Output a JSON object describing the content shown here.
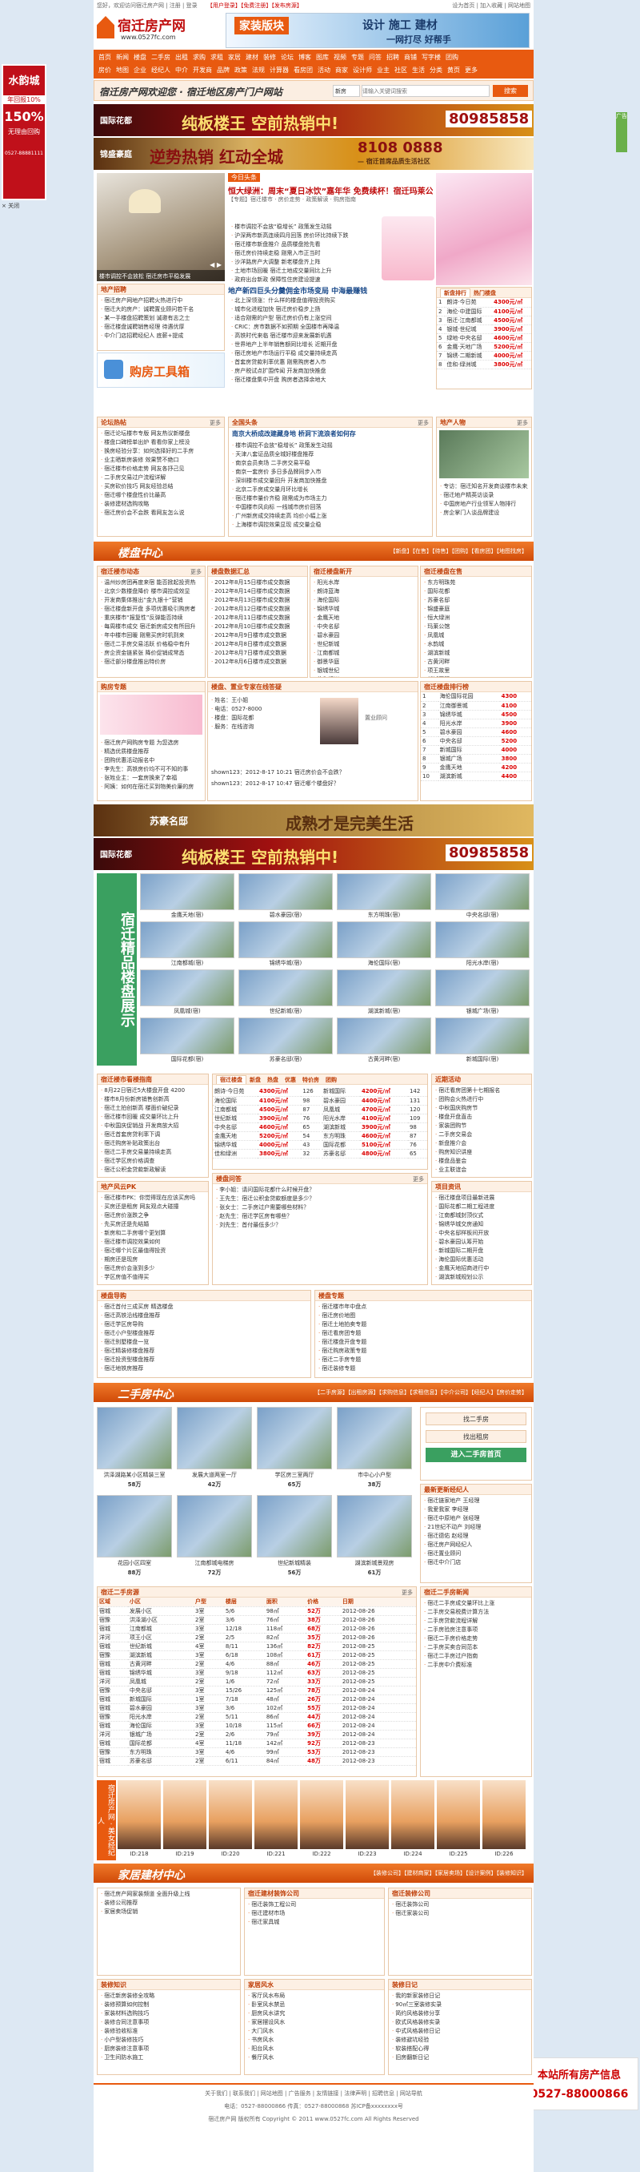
{
  "topbar": {
    "left": "您好，欢迎访问宿迁房产网 | 注册 | 登录",
    "mid": "【用户登录】【免费注册】【发布房源】",
    "right": "设为首页 | 加入收藏 | 网站地图"
  },
  "logo": {
    "cn": "宿迁房产网",
    "url": "www.0527fc.com"
  },
  "header_ad": {
    "left": "家装版块",
    "right": "设计 施工 建材",
    "sub": "一网打尽 好帮手"
  },
  "nav": {
    "row1": [
      "首页",
      "新闻",
      "楼盘",
      "二手房",
      "出租",
      "求购",
      "求租",
      "家居",
      "建材",
      "装修",
      "论坛",
      "博客",
      "图库",
      "视频",
      "专题",
      "问答",
      "招聘",
      "商铺",
      "写字楼",
      "团购"
    ],
    "row2": [
      "房价",
      "地图",
      "企业",
      "经纪人",
      "中介",
      "开发商",
      "品牌",
      "政策",
      "法规",
      "计算器",
      "看房团",
      "活动",
      "商家",
      "设计师",
      "业主",
      "社区",
      "生活",
      "分类",
      "黄页",
      "更多"
    ]
  },
  "slogan": "宿迁房产网欢迎您 · 宿迁地区房产门户网站",
  "search": {
    "placeholder": "请输入关键词搜索",
    "select": "新房",
    "button": "搜索"
  },
  "ads": {
    "gold_phone": "80985858",
    "gold_title": "纯板楼王 空前热销中!",
    "gold_brand": "国际花都",
    "red_title": "逆势热销 红动全城",
    "red_phone": "8108 0888",
    "red_brand": "锦盛豪庭",
    "red_sub": "— 宿迁首席品质生活社区",
    "sugar_brand": "苏豪名邸",
    "sugar_title": "成熟才是完美生活",
    "left_float": {
      "name": "水韵城",
      "line1": "年回报10%",
      "line2": "150%",
      "line3": "无理由回购",
      "phone": "0527-88881111"
    },
    "right_float": {
      "title": "本站所有房产信息",
      "phone": "0527-88000866"
    }
  },
  "headline": {
    "tag": "今日头条",
    "title1": "恒大绿洲：周末“夏日冰饮”嘉年华 免费续杯！宿迁玛莱公馆：沐周周",
    "sub": "【专题】宿迁楼市 · 房价走势 · 政策解读 · 购房指南",
    "items": [
      "楼市调控不会放“稳增长” 政策发生动摇",
      "沪深两市新高连续四月回落 房价环比持续下跌",
      "宿迁楼市新盘推介 品质楼盘抢先看",
      "宿迁房价持续走稳 刚需入市正当时",
      "沙洋路房产大调整 新老楼盘齐上阵",
      "土地市场回暖 宿迁土地成交量同比上升",
      "政府出台新政 保障性住房建设提速"
    ],
    "title2": "地产新四巨头分羹佣金市场变局 中海最赚钱",
    "items2": [
      "北上深领涨：什么样的楼盘值得投资购买",
      "城市化进程加快 宿迁房价稳步上扬",
      "适合刚需的户型 宿迁房价仍有上涨空间",
      "CRIC：房市数据不如预期 全国楼市再降温",
      "高铁时代来临 宿迁楼市迎来发展新机遇",
      "世界地产上半年销售额同比增长 近期开盘",
      "宿迁房地产市场运行平稳 成交量持续走高",
      "首套房贷款利率优惠 刚需购房者入市",
      "房产税试点扩围传闻 开发商加快推盘",
      "宿迁楼盘集中开盘 购房者选择余地大"
    ]
  },
  "slide": {
    "caption": "楼市调控不会放松 宿迁房市平稳发展"
  },
  "recruit": {
    "title": "地产招聘",
    "items": [
      "宿迁房产网地产招聘火热进行中",
      "宿迁大的房产：诚聘置业顾问若干名",
      "某一手楼盘招聘策划 诚邀有志之士",
      "宿迁楼盘诚聘销售经理 待遇优厚",
      "中介门店招聘经纪人 底薪+提成"
    ]
  },
  "buytool": {
    "title": "购房工具箱"
  },
  "rank": {
    "tabs": [
      "新盘排行",
      "热门楼盘"
    ],
    "rows": [
      [
        "1",
        "朗诗·今日苑",
        "4300元/㎡"
      ],
      [
        "2",
        "海伦·中建国际",
        "4100元/㎡"
      ],
      [
        "3",
        "宿迁·江南都城",
        "4500元/㎡"
      ],
      [
        "4",
        "银城·世纪城",
        "3900元/㎡"
      ],
      [
        "5",
        "绿地·中央名邸",
        "4600元/㎡"
      ],
      [
        "6",
        "金鹰·天地广场",
        "5200元/㎡"
      ],
      [
        "7",
        "锦绣·二期新城",
        "4000元/㎡"
      ],
      [
        "8",
        "佳和·绿洲城",
        "3800元/㎡"
      ]
    ]
  },
  "forum": {
    "title": "论坛热帖",
    "items": [
      "宿迁论坛楼市专版 网友热议新楼盘",
      "楼盘口碑榜单出炉 看看你家上榜没",
      "换房经验分享：如何选择好的二手房",
      "业主晒新房装修 效果赞不绝口",
      "宿迁楼市价格走势 网友各抒己见",
      "二手房交易过户流程详解",
      "买房砍价技巧 网友经验总结",
      "宿迁哪个楼盘性价比最高",
      "装修建材选购攻略",
      "宿迁房价会不会跌 看网友怎么说"
    ]
  },
  "national": {
    "title": "全国头条",
    "headline": "南京大桥成改建藏身地 桥洞下流浪者如何存",
    "items": [
      "楼市调控不会放“稳增长” 政策发生动摇",
      "天津八套证品质全城好楼盘推荐",
      "南京会员卖场 二手房交易平稳",
      "南京一套房价 多日多品牌同步入市",
      "深圳楼市成交量回升 开发商加快推盘",
      "北京二手房成交量月环比增长",
      "宿迁楼市量价齐稳 刚需成为市场主力",
      "中国楼市风向标 一线城市房价回落",
      "广州新房成交持续走高 均价小幅上涨",
      "上海楼市调控效果显现 成交量企稳"
    ]
  },
  "owner": {
    "title": "地产人物",
    "items": [
      "专访：宿迁知名开发商谈楼市未来走向",
      "宿迁地产精英访谈录",
      "中国房地产行业领军人物排行",
      "房企掌门人谈品牌建设"
    ]
  },
  "sections": {
    "loupan": "楼盘中心",
    "ershou": "二手房中心",
    "jiaju": "家居建材中心"
  },
  "loupan_links": "【新盘】【在售】【待售】【团购】【看房团】【地图找房】",
  "lp_news": {
    "title": "宿迁楼市动态",
    "items": [
      "温州炒房团再度来宿 能否掀起投资热",
      "北京少数楼盘降价 楼市调控成效显",
      "开发商集体推出“金九银十”营销",
      "宿迁楼盘新开盘 多项优惠吸引购房者",
      "重庆楼市“报复性”反弹能否持续",
      "每周楼市成交 宿迁新房成交有所回升",
      "年中楼市回暖 刚需买房时机到来",
      "宿迁二手房交易活跃 价格稳中有升",
      "房企资金链紧张 降价促销成常态",
      "宿迁部分楼盘推出特价房"
    ]
  },
  "lp_week": {
    "title": "楼盘数据汇总",
    "items": [
      "2012年8月15日楼市成交数据",
      "2012年8月14日楼市成交数据",
      "2012年8月13日楼市成交数据",
      "2012年8月12日楼市成交数据",
      "2012年8月11日楼市成交数据",
      "2012年8月10日楼市成交数据",
      "2012年8月9日楼市成交数据",
      "2012年8月8日楼市成交数据",
      "2012年8月7日楼市成交数据",
      "2012年8月6日楼市成交数据"
    ]
  },
  "lp_new": {
    "title": "宿迁楼盘新开",
    "items": [
      "阳光水岸",
      "朗诗蓝海",
      "海伦国际",
      "锦绣华城",
      "金鹰天地",
      "中央名邸",
      "碧水豪园",
      "世纪新城",
      "江南都城",
      "御景华庭",
      "银城世纪",
      "佳和绿洲"
    ]
  },
  "lp_sale": {
    "title": "宿迁楼盘在售",
    "items": [
      "东方明珠苑",
      "国际花都",
      "苏豪名邸",
      "锦盛豪庭",
      "恒大绿洲",
      "玛莱公馆",
      "凤凰城",
      "水韵城",
      "湖滨新城",
      "古黄河畔",
      "项王故里",
      "新城国际"
    ]
  },
  "mypage": {
    "title": "购房专题",
    "items": [
      "宿迁房产网购房专题 为您选房",
      "精选优质楼盘推荐",
      "团购优惠活动报名中",
      "李先生：高铁房价均不可不知的事",
      "张姓业主：一套房换来了幸福",
      "阿姨：如何在宿迁买到物美价廉的房"
    ]
  },
  "consult": {
    "title": "楼盘、置业专家在线答疑",
    "expert": "置业顾问",
    "info": [
      "姓名：王小姐",
      "电话：0527-8000",
      "楼盘：国际花都",
      "服务：在线咨询"
    ],
    "q1": "shown123：2012-8-17 10:21 宿迁房价会不会跌？",
    "q2": "shown123：2012-8-17 10:47 宿迁哪个楼盘好？"
  },
  "lp_rank": {
    "title": "宿迁楼盘排行榜",
    "rows": [
      [
        "1",
        "海伦国际花园",
        "4300"
      ],
      [
        "2",
        "江南御景城",
        "4100"
      ],
      [
        "3",
        "锦绣华城",
        "4500"
      ],
      [
        "4",
        "阳光水岸",
        "3900"
      ],
      [
        "5",
        "碧水豪园",
        "4600"
      ],
      [
        "6",
        "中央名邸",
        "5200"
      ],
      [
        "7",
        "新城国际",
        "4000"
      ],
      [
        "8",
        "银城广场",
        "3800"
      ],
      [
        "9",
        "金鹰天地",
        "4200"
      ],
      [
        "10",
        "湖滨新城",
        "4400"
      ]
    ]
  },
  "gallery": {
    "title": "宿迁精品楼盘展示",
    "items": [
      "金鹰天地(宿)",
      "碧水豪园(宿)",
      "东方明珠(宿)",
      "中央名邸(宿)",
      "江南都城(宿)",
      "锦绣华城(宿)",
      "海伦国际(宿)",
      "阳光水岸(宿)",
      "凤凰城(宿)",
      "世纪新城(宿)",
      "湖滨新城(宿)",
      "银城广场(宿)",
      "国际花都(宿)",
      "苏豪名邸(宿)",
      "古黄河畔(宿)",
      "新城国际(宿)"
    ]
  },
  "market": {
    "title": "宿迁楼市看楼指南",
    "items": [
      "8月22日宿迁5大楼盘开盘 4200",
      "楼市8月份新房销售创新高",
      "宿迁土拍创新高 楼面价破纪录",
      "宿迁楼市回暖 成交量环比上升",
      "中秋国庆促销战 开发商放大招",
      "宿迁首套房贷利率下调",
      "宿迁购房补贴政策出台",
      "宿迁二手房交易量持续走高",
      "宿迁学区房价格调查",
      "宿迁公积金贷款新政解读"
    ]
  },
  "pk": {
    "title": "地产风云PK",
    "items": [
      "宿迁楼市PK：你觉得现在应该买房吗",
      "买房还是租房 网友观点大碰撞",
      "宿迁房价涨跌之争",
      "先买房还是先结婚",
      "新房和二手房哪个更划算",
      "宿迁楼市调控效果如何",
      "宿迁哪个片区最值得投资",
      "期房还是现房",
      "宿迁房价会涨到多少",
      "学区房值不值得买"
    ]
  },
  "hot": {
    "tabs": [
      "宿迁楼盘",
      "新盘",
      "热盘",
      "优惠",
      "特价房",
      "团购"
    ],
    "left": [
      [
        "朗诗·今日苑",
        "4300元/㎡",
        "126"
      ],
      [
        "海伦国际",
        "4100元/㎡",
        "98"
      ],
      [
        "江南都城",
        "4500元/㎡",
        "87"
      ],
      [
        "世纪新城",
        "3900元/㎡",
        "76"
      ],
      [
        "中央名邸",
        "4600元/㎡",
        "65"
      ],
      [
        "金鹰天地",
        "5200元/㎡",
        "54"
      ],
      [
        "锦绣华城",
        "4000元/㎡",
        "43"
      ],
      [
        "佳和绿洲",
        "3800元/㎡",
        "32"
      ]
    ],
    "right": [
      [
        "新城国际",
        "4200元/㎡",
        "142"
      ],
      [
        "碧水豪园",
        "4400元/㎡",
        "131"
      ],
      [
        "凤凰城",
        "4700元/㎡",
        "120"
      ],
      [
        "阳光水岸",
        "4100元/㎡",
        "109"
      ],
      [
        "湖滨新城",
        "3900元/㎡",
        "98"
      ],
      [
        "东方明珠",
        "4600元/㎡",
        "87"
      ],
      [
        "国际花都",
        "5100元/㎡",
        "76"
      ],
      [
        "苏豪名邸",
        "4800元/㎡",
        "65"
      ]
    ]
  },
  "ask": {
    "title": "楼盘问答",
    "items": [
      "李小姐：请问国际花都什么时候开盘？",
      "王先生：宿迁公积金贷款额度是多少？",
      "张女士：二手房过户需要哪些材料？",
      "赵先生：宿迁学区房有哪些？",
      "刘先生：首付最低多少？"
    ]
  },
  "activity": {
    "title": "近期活动",
    "items": [
      "宿迁看房团第十七期报名",
      "团购会火热进行中",
      "中秋国庆购房节",
      "楼盘开盘直击",
      "家装团购节",
      "二手房交易会",
      "新盘推介会",
      "购房知识讲座",
      "楼盘品鉴会",
      "业主联谊会"
    ]
  },
  "project": {
    "title": "项目资讯",
    "items": [
      "宿迁楼盘项目最新进展",
      "国际花都二期工程进度",
      "江南都城封顶仪式",
      "锦绣华城交房通知",
      "中央名邸样板间开放",
      "碧水豪园认筹开始",
      "新城国际二期开盘",
      "海伦国际优惠活动",
      "金鹰天地招商进行中",
      "湖滨新城规划公示"
    ]
  },
  "lp_bot": {
    "a_title": "楼盘导购",
    "b_title": "楼盘专题",
    "a": [
      "宿迁首付三成买房 精选楼盘",
      "宿迁高铁沿线楼盘推荐",
      "宿迁学区房导购",
      "宿迁小户型楼盘推荐",
      "宿迁别墅楼盘一览",
      "宿迁精装修楼盘推荐",
      "宿迁投资型楼盘推荐",
      "宿迁地铁房推荐"
    ],
    "b": [
      "宿迁楼市年中盘点",
      "宿迁房价地图",
      "宿迁土地拍卖专题",
      "宿迁看房团专题",
      "宿迁楼盘开盘专题",
      "宿迁购房政策专题",
      "宿迁二手房专题",
      "宿迁装修专题"
    ]
  },
  "es_links": "【二手房源】【出租房源】【求购信息】【求租信息】【中介公司】【经纪人】【房价走势】",
  "es_gallery": [
    {
      "n": "洪泽湖路某小区精装三室",
      "p": "58万"
    },
    {
      "n": "发展大道两室一厅",
      "p": "42万"
    },
    {
      "n": "学区房三室两厅",
      "p": "65万"
    },
    {
      "n": "市中心小户型",
      "p": "38万"
    },
    {
      "n": "花园小区四室",
      "p": "88万"
    },
    {
      "n": "江南都城电梯房",
      "p": "72万"
    },
    {
      "n": "世纪新城精装",
      "p": "56万"
    },
    {
      "n": "湖滨新城景观房",
      "p": "61万"
    }
  ],
  "es_search": {
    "btn1": "找二手房",
    "btn2": "找出租房",
    "btn3": "进入二手房首页"
  },
  "es_agent": {
    "title": "最新更新经纪人",
    "items": [
      "宿迁链家地产 王经理",
      "我爱我家 李经理",
      "宿迁中原地产 张经理",
      "21世纪不动产 刘经理",
      "宿迁德佑 赵经理",
      "宿迁房产网经纪人",
      "宿迁置业顾问",
      "宿迁中介门店"
    ]
  },
  "es_table": {
    "title": "宿迁二手房源",
    "head": [
      "区域",
      "小区",
      "户型",
      "楼层",
      "面积",
      "价格",
      "日期"
    ],
    "rows": [
      [
        "宿城",
        "发展小区",
        "3室",
        "5/6",
        "98㎡",
        "52万",
        "2012-08-26"
      ],
      [
        "宿豫",
        "洪泽湖小区",
        "2室",
        "3/6",
        "76㎡",
        "38万",
        "2012-08-26"
      ],
      [
        "宿城",
        "江南都城",
        "3室",
        "12/18",
        "118㎡",
        "68万",
        "2012-08-26"
      ],
      [
        "洋河",
        "项王小区",
        "2室",
        "2/5",
        "82㎡",
        "35万",
        "2012-08-26"
      ],
      [
        "宿城",
        "世纪新城",
        "4室",
        "8/11",
        "136㎡",
        "82万",
        "2012-08-25"
      ],
      [
        "宿豫",
        "湖滨新城",
        "3室",
        "6/18",
        "108㎡",
        "61万",
        "2012-08-25"
      ],
      [
        "宿城",
        "古黄河畔",
        "2室",
        "4/6",
        "88㎡",
        "46万",
        "2012-08-25"
      ],
      [
        "宿城",
        "锦绣华城",
        "3室",
        "9/18",
        "112㎡",
        "63万",
        "2012-08-25"
      ],
      [
        "洋河",
        "凤凰城",
        "2室",
        "1/6",
        "72㎡",
        "33万",
        "2012-08-25"
      ],
      [
        "宿豫",
        "中央名邸",
        "3室",
        "15/26",
        "125㎡",
        "78万",
        "2012-08-24"
      ],
      [
        "宿城",
        "新城国际",
        "1室",
        "7/18",
        "48㎡",
        "26万",
        "2012-08-24"
      ],
      [
        "宿城",
        "碧水豪园",
        "3室",
        "3/6",
        "102㎡",
        "55万",
        "2012-08-24"
      ],
      [
        "宿豫",
        "阳光水岸",
        "2室",
        "5/11",
        "86㎡",
        "44万",
        "2012-08-24"
      ],
      [
        "宿城",
        "海伦国际",
        "3室",
        "10/18",
        "115㎡",
        "66万",
        "2012-08-24"
      ],
      [
        "洋河",
        "银城广场",
        "2室",
        "2/6",
        "79㎡",
        "39万",
        "2012-08-24"
      ],
      [
        "宿城",
        "国际花都",
        "4室",
        "11/18",
        "142㎡",
        "92万",
        "2012-08-23"
      ],
      [
        "宿豫",
        "东方明珠",
        "3室",
        "4/6",
        "99㎡",
        "53万",
        "2012-08-23"
      ],
      [
        "宿城",
        "苏豪名邸",
        "2室",
        "6/11",
        "84㎡",
        "48万",
        "2012-08-23"
      ]
    ]
  },
  "es_news": {
    "title": "宿迁二手房新闻",
    "items": [
      "宿迁二手房成交量环比上涨",
      "二手房交易税费计算方法",
      "二手房贷款流程详解",
      "二手房验房注意事项",
      "宿迁二手房价格走势",
      "二手房买卖合同范本",
      "宿迁二手房过户指南",
      "二手房中介费标准"
    ]
  },
  "es_show": {
    "title": "宿迁房产网 · 美女经纪人",
    "items": [
      "ID:218",
      "ID:219",
      "ID:220",
      "ID:221",
      "ID:222",
      "ID:223",
      "ID:224",
      "ID:225",
      "ID:226"
    ]
  },
  "jj_links": "【装修公司】【建材商家】【家居卖场】【设计案例】【装修知识】",
  "jj": {
    "a": [
      "宿迁房产网家装频道 全面升级上线",
      "装修公司推荐",
      "家居卖场促销"
    ],
    "b_title": "宿迁建材装饰公司",
    "b": [
      "宿迁装饰工程公司",
      "宿迁建材市场",
      "宿迁家具城"
    ],
    "c_title": "宿迁装修公司",
    "c": [
      "宿迁装饰公司",
      "宿迁家装公司"
    ]
  },
  "jj_bot": {
    "a_title": "装修知识",
    "b_title": "家居风水",
    "c_title": "装修日记",
    "a": [
      "宿迁新房装修全攻略",
      "装修预算如何控制",
      "家装材料选购技巧",
      "装修合同注意事项",
      "装修验收标准",
      "小户型装修技巧",
      "厨房装修注意事项",
      "卫生间防水施工"
    ],
    "b": [
      "客厅风水布局",
      "卧室风水禁忌",
      "厨房风水讲究",
      "家居摆设风水",
      "大门风水",
      "书房风水",
      "阳台风水",
      "餐厅风水"
    ],
    "c": [
      "我的新家装修日记",
      "90㎡三室装修实录",
      "简约风格装修分享",
      "欧式风格装修实录",
      "中式风格装修日记",
      "装修避坑经验",
      "软装搭配心得",
      "旧房翻新日记"
    ]
  },
  "footer": {
    "links": "关于我们 | 联系我们 | 网站地图 | 广告服务 | 友情链接 | 法律声明 | 招聘信息 | 网站导航",
    "copy": "宿迁房产网 版权所有 Copyright © 2011 www.0527fc.com All Rights Reserved",
    "tel": "电话：0527-88000866 传真：0527-88000868 苏ICP备xxxxxxxx号"
  }
}
